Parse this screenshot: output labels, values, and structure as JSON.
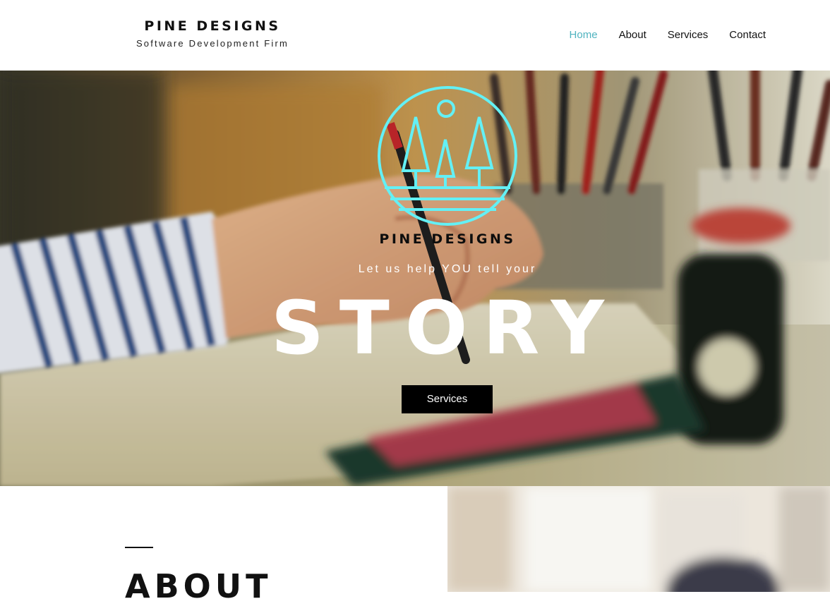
{
  "header": {
    "brand_name": "PINE DESIGNS",
    "tagline": "Software Development Firm",
    "nav": [
      {
        "label": "Home",
        "active": true
      },
      {
        "label": "About",
        "active": false
      },
      {
        "label": "Services",
        "active": false
      },
      {
        "label": "Contact",
        "active": false
      }
    ]
  },
  "hero": {
    "logo_icon": "pine-trees-logo-icon",
    "brand_name": "PINE DESIGNS",
    "subtitle": "Let us help YOU tell your",
    "title": "STORY",
    "button_label": "Services"
  },
  "about": {
    "title": "ABOUT"
  },
  "colors": {
    "accent": "#4fb3bf",
    "logo": "#63f0f5",
    "button_bg": "#000000",
    "text": "#111111"
  }
}
